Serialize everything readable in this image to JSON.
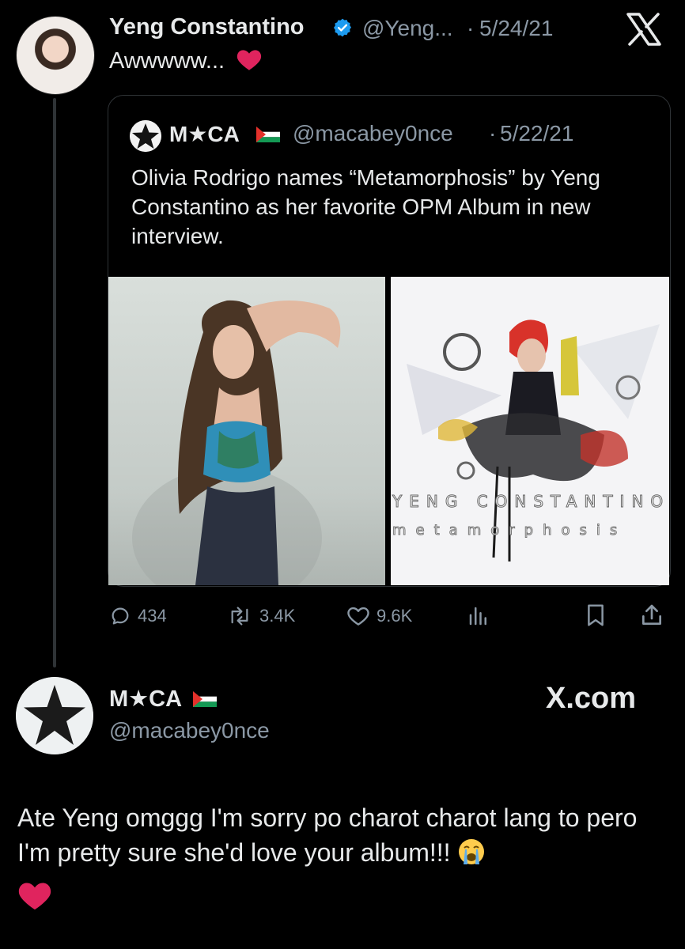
{
  "tweet": {
    "author_name": "Yeng Constantino",
    "handle": "@Yeng...",
    "separator": "·",
    "date": "5/24/21",
    "text": "Awwwww...",
    "icons": {
      "verified": "verified-badge-icon",
      "close": "x-logo-icon",
      "reaction": "red-heart-icon"
    },
    "colors": {
      "verified": "#1d9bf0",
      "heart": "#e0245e"
    }
  },
  "quoted": {
    "author_name": "M★CA",
    "flag": "palestine-flag-icon",
    "handle": "@macabey0nce",
    "separator": "·",
    "date": "5/22/21",
    "text": "Olivia Rodrigo names “Metamorphosis” by Yeng Constantino as her favorite OPM Album in new interview.",
    "images": {
      "left": "olivia-rodrigo-photo",
      "right": "metamorphosis-album-cover",
      "cover_title": "YENG CONSTANTINO",
      "cover_subtitle": "metamorphosis"
    }
  },
  "actions": {
    "replies": "434",
    "retweets": "3.4K",
    "likes": "9.6K"
  },
  "post": {
    "author_name": "M★CA",
    "handle": "@macabey0nce",
    "site": "X.com",
    "text": "Ate Yeng omggg I'm sorry po charot charot lang to pero I'm pretty sure she'd love your album!!!",
    "emoji": "loudly-crying-face-icon",
    "trailing_emoji": "red-heart-icon"
  }
}
